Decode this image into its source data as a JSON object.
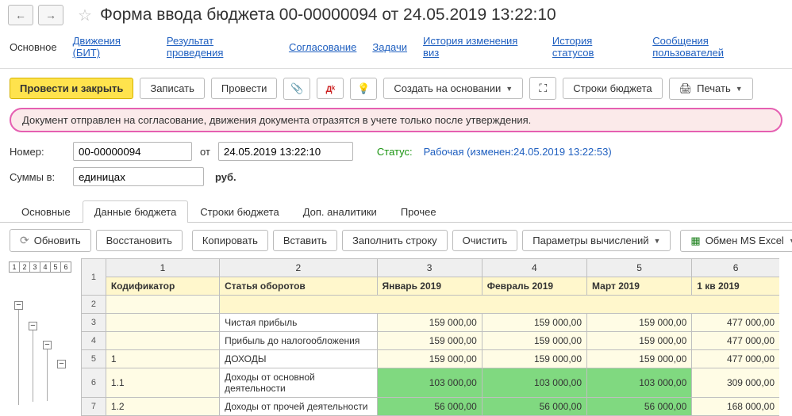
{
  "header": {
    "title": "Форма ввода бюджета 00-00000094 от 24.05.2019 13:22:10"
  },
  "links": {
    "current": "Основное",
    "items": [
      "Движения (БИТ)",
      "Результат проведения",
      "Согласование",
      "Задачи",
      "История изменения виз",
      "История статусов",
      "Сообщения пользователей"
    ]
  },
  "toolbar": {
    "post_close": "Провести и закрыть",
    "save": "Записать",
    "post": "Провести",
    "create_based": "Создать на основании",
    "budget_rows": "Строки бюджета",
    "print": "Печать"
  },
  "banner": "Документ отправлен на согласование, движения документа отразятся в учете только после утверждения.",
  "form": {
    "num_lbl": "Номер:",
    "num_val": "00-00000094",
    "from_lbl": "от",
    "date_val": "24.05.2019 13:22:10",
    "status_lbl": "Статус:",
    "status_val": "Рабочая (изменен:24.05.2019 13:22:53)",
    "sums_lbl": "Суммы в:",
    "sums_val": "единицах",
    "currency": "руб."
  },
  "tabs": [
    "Основные",
    "Данные бюджета",
    "Строки бюджета",
    "Доп. аналитики",
    "Прочее"
  ],
  "tabs_active": 1,
  "subtool": {
    "refresh": "Обновить",
    "restore": "Восстановить",
    "copy": "Копировать",
    "paste": "Вставить",
    "fill_row": "Заполнить строку",
    "clear": "Очистить",
    "calc_params": "Параметры вычислений",
    "excel": "Обмен MS Excel"
  },
  "levels": [
    "1",
    "2",
    "3",
    "4",
    "5",
    "6"
  ],
  "grid": {
    "col_nums": [
      "1",
      "2",
      "3",
      "4",
      "5",
      "6"
    ],
    "headers": {
      "code": "Кодификатор",
      "article": "Статья оборотов",
      "m1": "Январь 2019",
      "m2": "Февраль 2019",
      "m3": "Март 2019",
      "q1": "1 кв 2019"
    },
    "rows": [
      {
        "n": "3",
        "code": "",
        "article": "Чистая прибыль",
        "v": [
          "159 000,00",
          "159 000,00",
          "159 000,00",
          "477 000,00"
        ],
        "green": false,
        "yellow": true
      },
      {
        "n": "4",
        "code": "",
        "article": "Прибыль до налогообложения",
        "v": [
          "159 000,00",
          "159 000,00",
          "159 000,00",
          "477 000,00"
        ],
        "green": false,
        "yellow": true
      },
      {
        "n": "5",
        "code": "1",
        "article": "ДОХОДЫ",
        "v": [
          "159 000,00",
          "159 000,00",
          "159 000,00",
          "477 000,00"
        ],
        "green": false,
        "yellow": true
      },
      {
        "n": "6",
        "code": "1.1",
        "article": "Доходы от основной деятельности",
        "v": [
          "103 000,00",
          "103 000,00",
          "103 000,00",
          "309 000,00"
        ],
        "green": true,
        "yellow": true
      },
      {
        "n": "7",
        "code": "1.2",
        "article": "Доходы от прочей деятельности",
        "v": [
          "56 000,00",
          "56 000,00",
          "56 000,00",
          "168 000,00"
        ],
        "green": true,
        "yellow": true
      }
    ]
  }
}
